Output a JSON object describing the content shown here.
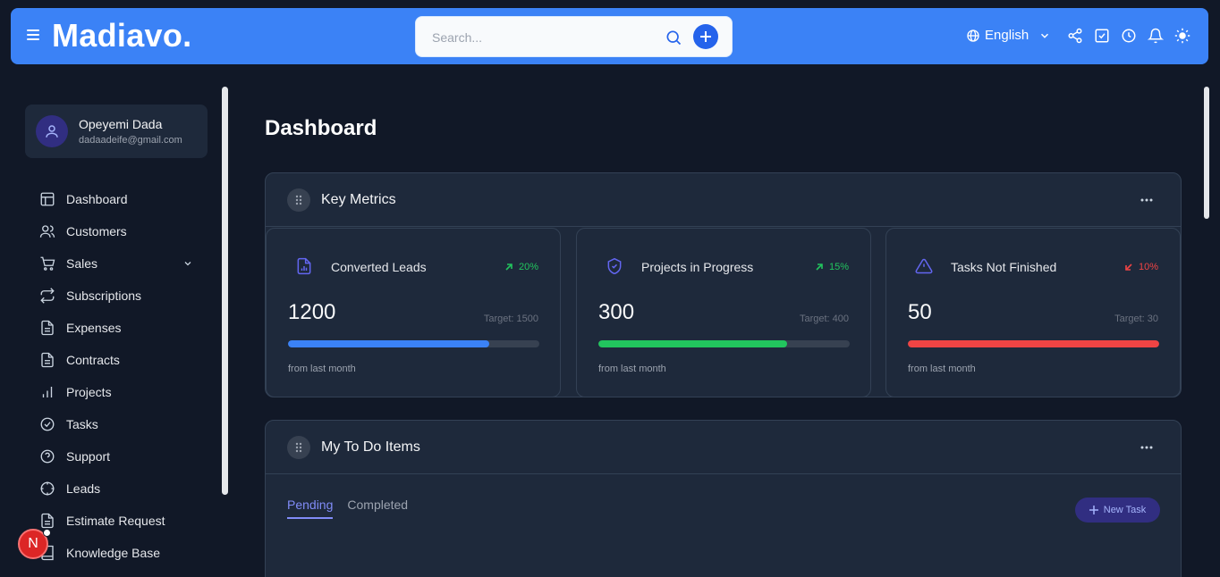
{
  "header": {
    "brand": "Madiavo.",
    "search_placeholder": "Search...",
    "language": "English"
  },
  "user": {
    "name": "Opeyemi Dada",
    "email": "dadaadeife@gmail.com"
  },
  "sidebar": {
    "items": [
      {
        "label": "Dashboard",
        "icon": "dashboard-icon"
      },
      {
        "label": "Customers",
        "icon": "users-icon"
      },
      {
        "label": "Sales",
        "icon": "cart-icon"
      },
      {
        "label": "Subscriptions",
        "icon": "repeat-icon"
      },
      {
        "label": "Expenses",
        "icon": "file-icon"
      },
      {
        "label": "Contracts",
        "icon": "file-icon"
      },
      {
        "label": "Projects",
        "icon": "bar-chart-icon"
      },
      {
        "label": "Tasks",
        "icon": "check-circle-icon"
      },
      {
        "label": "Support",
        "icon": "help-circle-icon"
      },
      {
        "label": "Leads",
        "icon": "crosshair-icon"
      },
      {
        "label": "Estimate Request",
        "icon": "file-icon"
      },
      {
        "label": "Knowledge Base",
        "icon": "book-icon"
      }
    ],
    "badge_letter": "N"
  },
  "page": {
    "title": "Dashboard"
  },
  "metrics_panel": {
    "title": "Key Metrics",
    "cards": [
      {
        "title": "Converted Leads",
        "trend": "20%",
        "trend_dir": "up",
        "value": "1200",
        "target": "Target: 1500",
        "progress": 0.8,
        "color": "#3b82f6",
        "footer": "from last month",
        "icon": "chart-file-icon"
      },
      {
        "title": "Projects in Progress",
        "trend": "15%",
        "trend_dir": "up",
        "value": "300",
        "target": "Target: 400",
        "progress": 0.75,
        "color": "#22c55e",
        "footer": "from last month",
        "icon": "shield-check-icon"
      },
      {
        "title": "Tasks Not Finished",
        "trend": "10%",
        "trend_dir": "down",
        "value": "50",
        "target": "Target: 30",
        "progress": 1.0,
        "color": "#ef4444",
        "footer": "from last month",
        "icon": "warning-icon"
      }
    ]
  },
  "todo_panel": {
    "title": "My To Do Items",
    "tabs": [
      "Pending",
      "Completed"
    ],
    "new_task_label": "New Task"
  },
  "colors": {
    "accent": "#3b82f6",
    "trend_up": "#22c55e",
    "trend_down": "#ef4444"
  }
}
